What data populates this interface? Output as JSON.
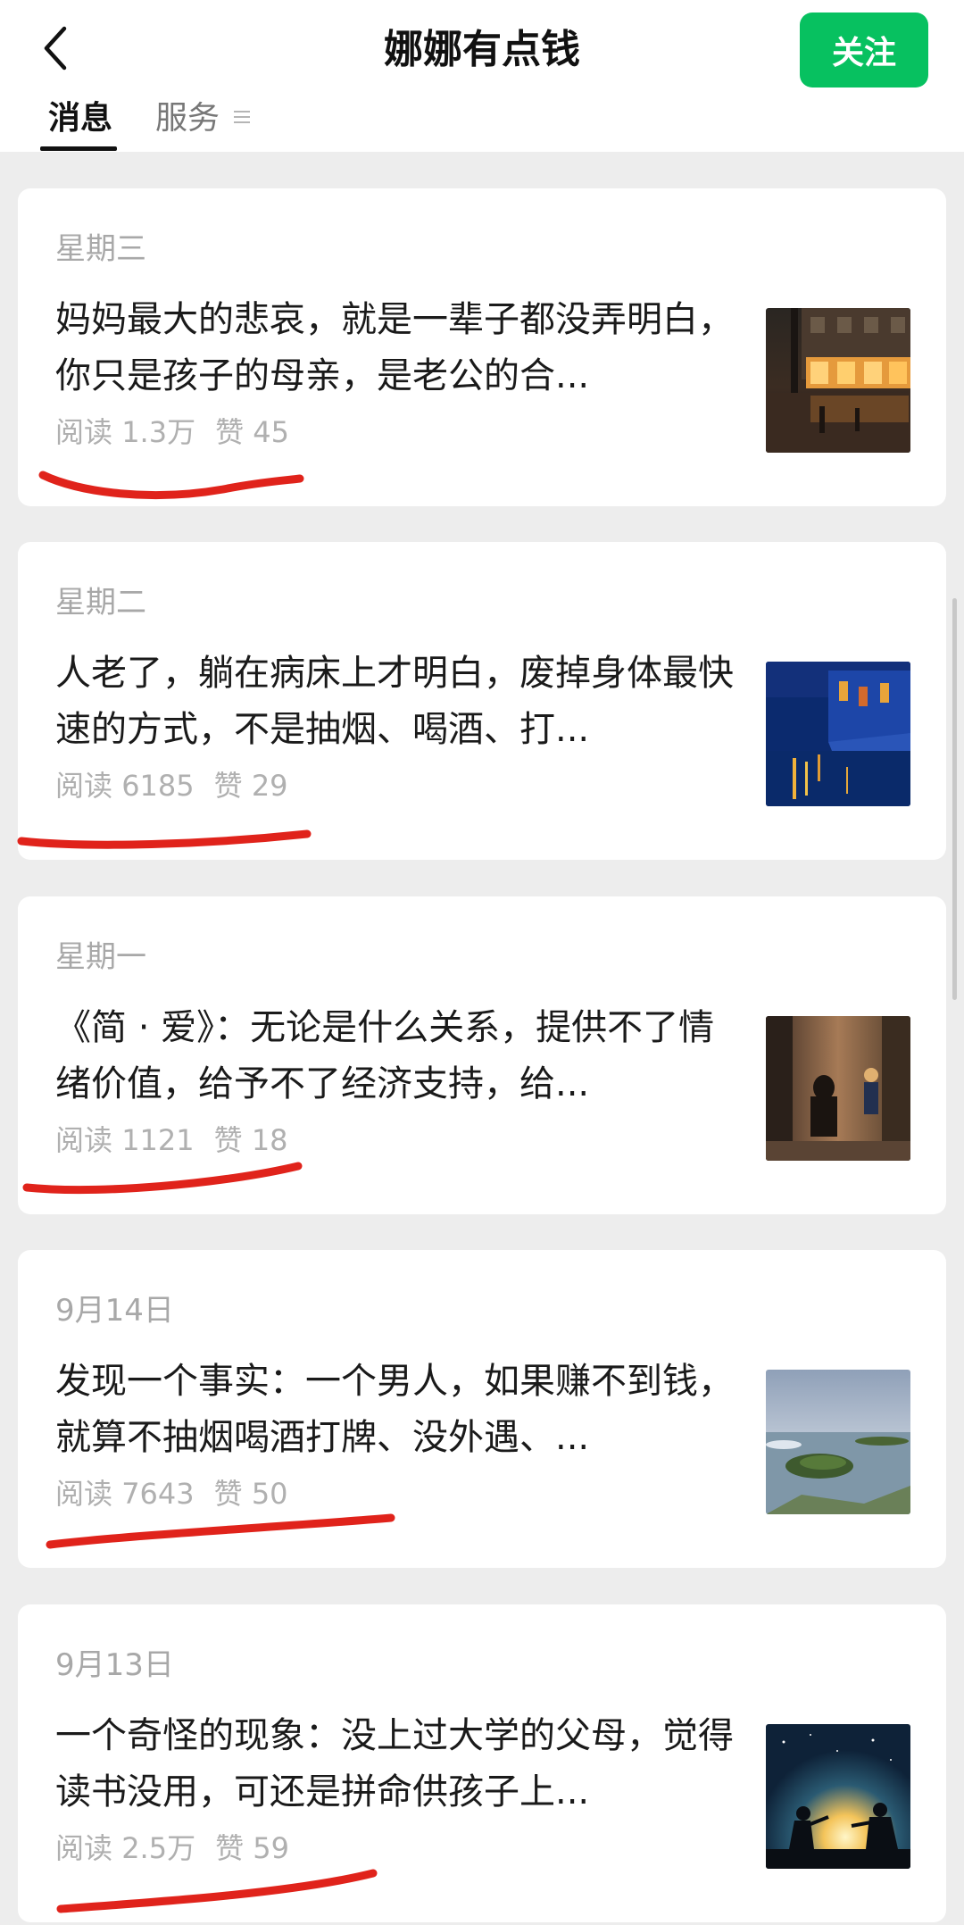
{
  "header": {
    "title": "娜娜有点钱",
    "follow_label": "关注",
    "tabs": [
      {
        "label": "消息",
        "active": true
      },
      {
        "label": "服务",
        "active": false
      }
    ]
  },
  "articles": [
    {
      "date": "星期三",
      "title": "妈妈最大的悲哀，就是一辈子都没弄明白，你只是孩子的母亲，是老公的合...",
      "reads_label": "阅读",
      "reads": "1.3万",
      "likes_label": "赞",
      "likes": "45"
    },
    {
      "date": "星期二",
      "title": "人老了，躺在病床上才明白，废掉身体最快速的方式，不是抽烟、喝酒、打...",
      "reads_label": "阅读",
      "reads": "6185",
      "likes_label": "赞",
      "likes": "29"
    },
    {
      "date": "星期一",
      "title": "《简 · 爱》：无论是什么关系，提供不了情绪价值，给予不了经济支持，给...",
      "reads_label": "阅读",
      "reads": "1121",
      "likes_label": "赞",
      "likes": "18"
    },
    {
      "date": "9月14日",
      "title": "发现一个事实：一个男人，如果赚不到钱，就算不抽烟喝酒打牌、没外遇、...",
      "reads_label": "阅读",
      "reads": "7643",
      "likes_label": "赞",
      "likes": "50"
    },
    {
      "date": "9月13日",
      "title": "一个奇怪的现象：没上过大学的父母，觉得读书没用，可还是拼命供孩子上...",
      "reads_label": "阅读",
      "reads": "2.5万",
      "likes_label": "赞",
      "likes": "59"
    }
  ],
  "colors": {
    "accent": "#07c160",
    "annotation": "#e0231b",
    "background": "#ededed"
  }
}
